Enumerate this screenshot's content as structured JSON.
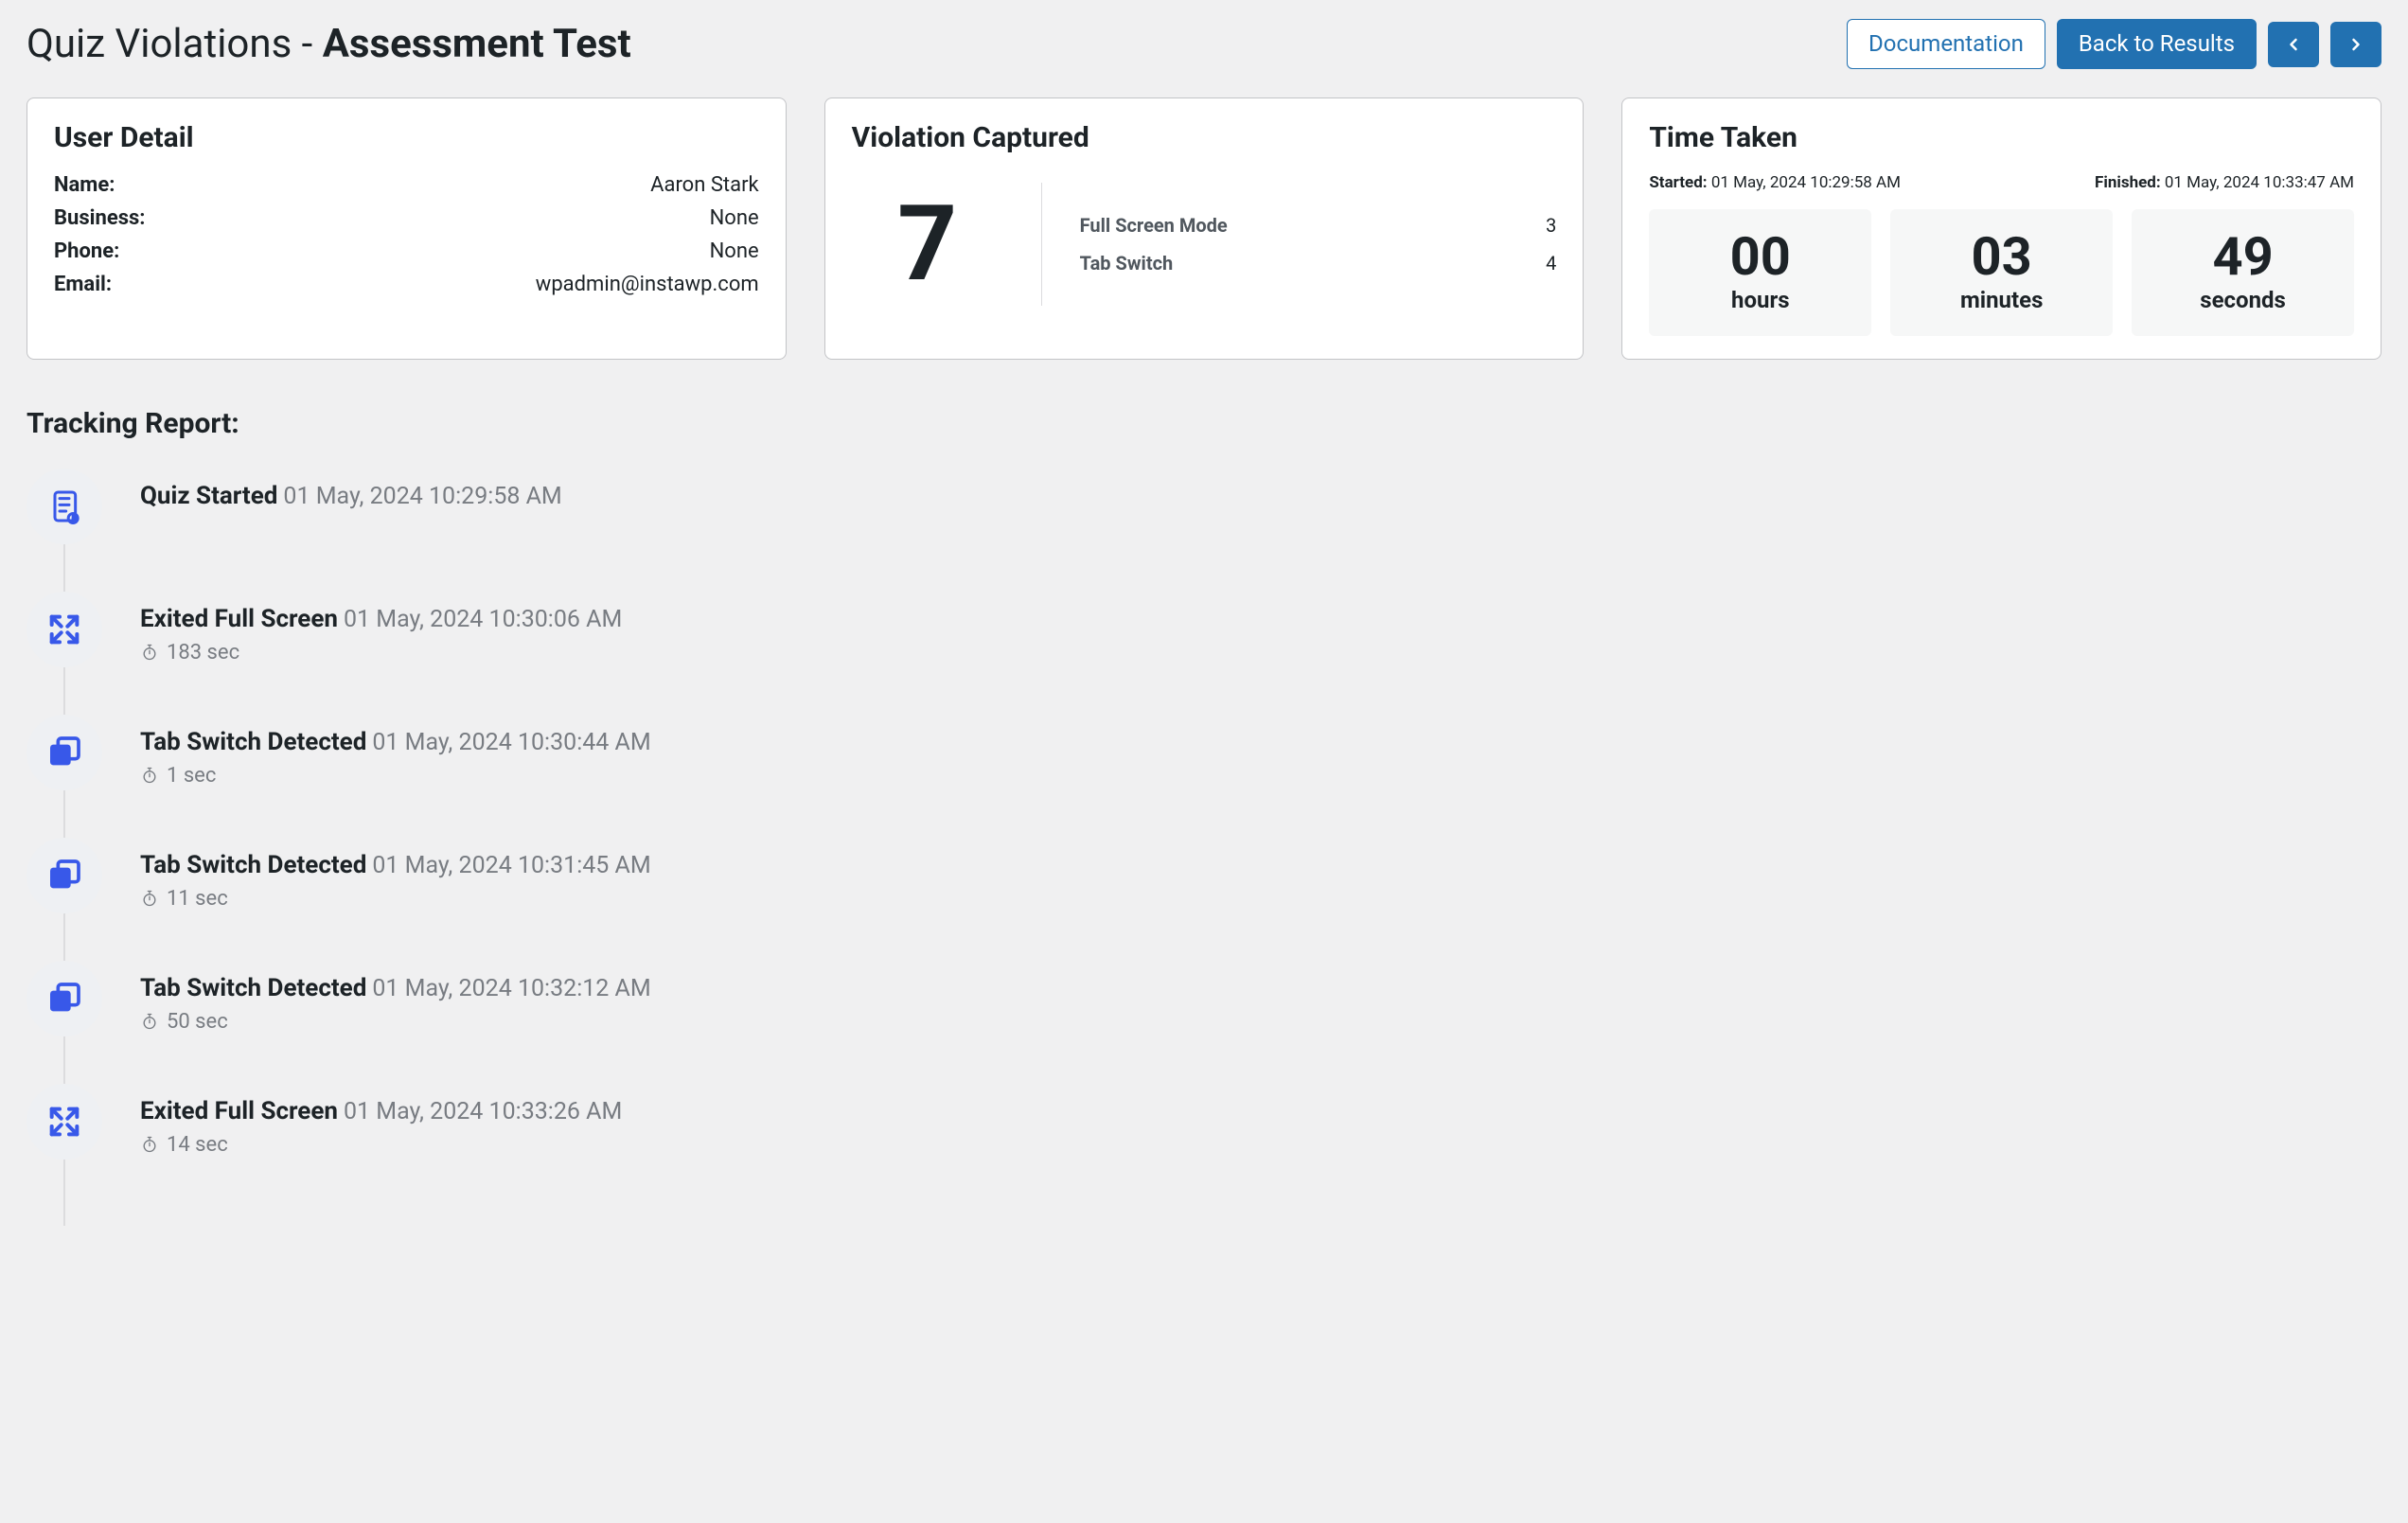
{
  "page": {
    "title_prefix": "Quiz Violations - ",
    "title_bold": "Assessment Test"
  },
  "actions": {
    "documentation": "Documentation",
    "back_to_results": "Back to Results"
  },
  "user_detail": {
    "title": "User Detail",
    "name_label": "Name:",
    "name_value": "Aaron Stark",
    "business_label": "Business:",
    "business_value": "None",
    "phone_label": "Phone:",
    "phone_value": "None",
    "email_label": "Email:",
    "email_value": "wpadmin@instawp.com"
  },
  "violation": {
    "title": "Violation Captured",
    "total": "7",
    "full_screen_label": "Full Screen Mode",
    "full_screen_value": "3",
    "tab_switch_label": "Tab Switch",
    "tab_switch_value": "4"
  },
  "time_taken": {
    "title": "Time Taken",
    "started_label": "Started:",
    "started_value": "01 May, 2024 10:29:58 AM",
    "finished_label": "Finished:",
    "finished_value": "01 May, 2024 10:33:47 AM",
    "hours": "00",
    "hours_unit": "hours",
    "minutes": "03",
    "minutes_unit": "minutes",
    "seconds": "49",
    "seconds_unit": "seconds"
  },
  "tracking": {
    "title": "Tracking Report:",
    "events": [
      {
        "title": "Quiz Started",
        "date": "01 May, 2024 10:29:58 AM",
        "duration": "",
        "icon": "quiz-start"
      },
      {
        "title": "Exited Full Screen",
        "date": "01 May, 2024 10:30:06 AM",
        "duration": "183 sec",
        "icon": "fullscreen"
      },
      {
        "title": "Tab Switch Detected",
        "date": "01 May, 2024 10:30:44 AM",
        "duration": "1 sec",
        "icon": "tab-switch"
      },
      {
        "title": "Tab Switch Detected",
        "date": "01 May, 2024 10:31:45 AM",
        "duration": "11 sec",
        "icon": "tab-switch"
      },
      {
        "title": "Tab Switch Detected",
        "date": "01 May, 2024 10:32:12 AM",
        "duration": "50 sec",
        "icon": "tab-switch"
      },
      {
        "title": "Exited Full Screen",
        "date": "01 May, 2024 10:33:26 AM",
        "duration": "14 sec",
        "icon": "fullscreen"
      }
    ]
  }
}
